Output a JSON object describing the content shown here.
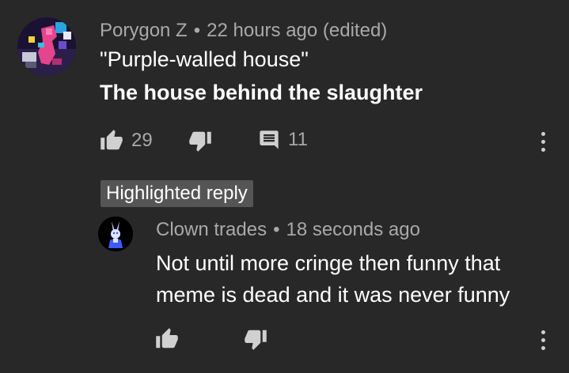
{
  "comment": {
    "author": "Porygon Z",
    "separator": "•",
    "timestamp": "22 hours ago (edited)",
    "lines": [
      "\"Purple-walled house\"",
      "The house behind the slaughter"
    ],
    "likes": "29",
    "replies": "11"
  },
  "highlight_label": "Highlighted reply",
  "reply": {
    "author": "Clown trades",
    "separator": "•",
    "timestamp": "18 seconds ago",
    "text": "Not until more cringe then funny that meme is dead and it was never funny"
  },
  "icons": {
    "like": "thumb-up-icon",
    "dislike": "thumb-down-icon",
    "reply": "comment-icon",
    "menu": "more-vertical-icon"
  },
  "colors": {
    "background": "#282828",
    "primary_text": "#ffffff",
    "secondary_text": "#a9a9a9",
    "badge": "#555555"
  }
}
